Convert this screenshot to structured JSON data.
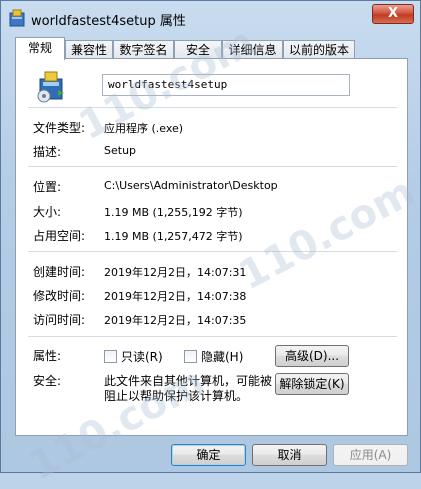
{
  "window": {
    "title": "worldfastest4setup 属性",
    "close_label": "X"
  },
  "tabs": [
    {
      "label": "常规",
      "active": true
    },
    {
      "label": "兼容性",
      "active": false
    },
    {
      "label": "数字签名",
      "active": false
    },
    {
      "label": "安全",
      "active": false
    },
    {
      "label": "详细信息",
      "active": false
    },
    {
      "label": "以前的版本",
      "active": false
    }
  ],
  "general": {
    "file_name": "worldfastest4setup",
    "file_type_label": "文件类型:",
    "file_type_value": "应用程序 (.exe)",
    "description_label": "描述:",
    "description_value": "Setup",
    "location_label": "位置:",
    "location_value": "C:\\Users\\Administrator\\Desktop",
    "size_label": "大小:",
    "size_value": "1.19 MB (1,255,192 字节)",
    "size_on_disk_label": "占用空间:",
    "size_on_disk_value": "1.19 MB (1,257,472 字节)",
    "created_label": "创建时间:",
    "created_value": "2019年12月2日，14:07:31",
    "modified_label": "修改时间:",
    "modified_value": "2019年12月2日，14:07:38",
    "accessed_label": "访问时间:",
    "accessed_value": "2019年12月2日，14:07:35",
    "attributes_label": "属性:",
    "readonly_label": "只读(R)",
    "hidden_label": "隐藏(H)",
    "advanced_button": "高级(D)...",
    "security_label": "安全:",
    "security_text": "此文件来自其他计算机，可能被阻止以帮助保护该计算机。",
    "unblock_button": "解除锁定(K)"
  },
  "footer": {
    "ok": "确定",
    "cancel": "取消",
    "apply": "应用(A)"
  },
  "watermark": "110.com"
}
